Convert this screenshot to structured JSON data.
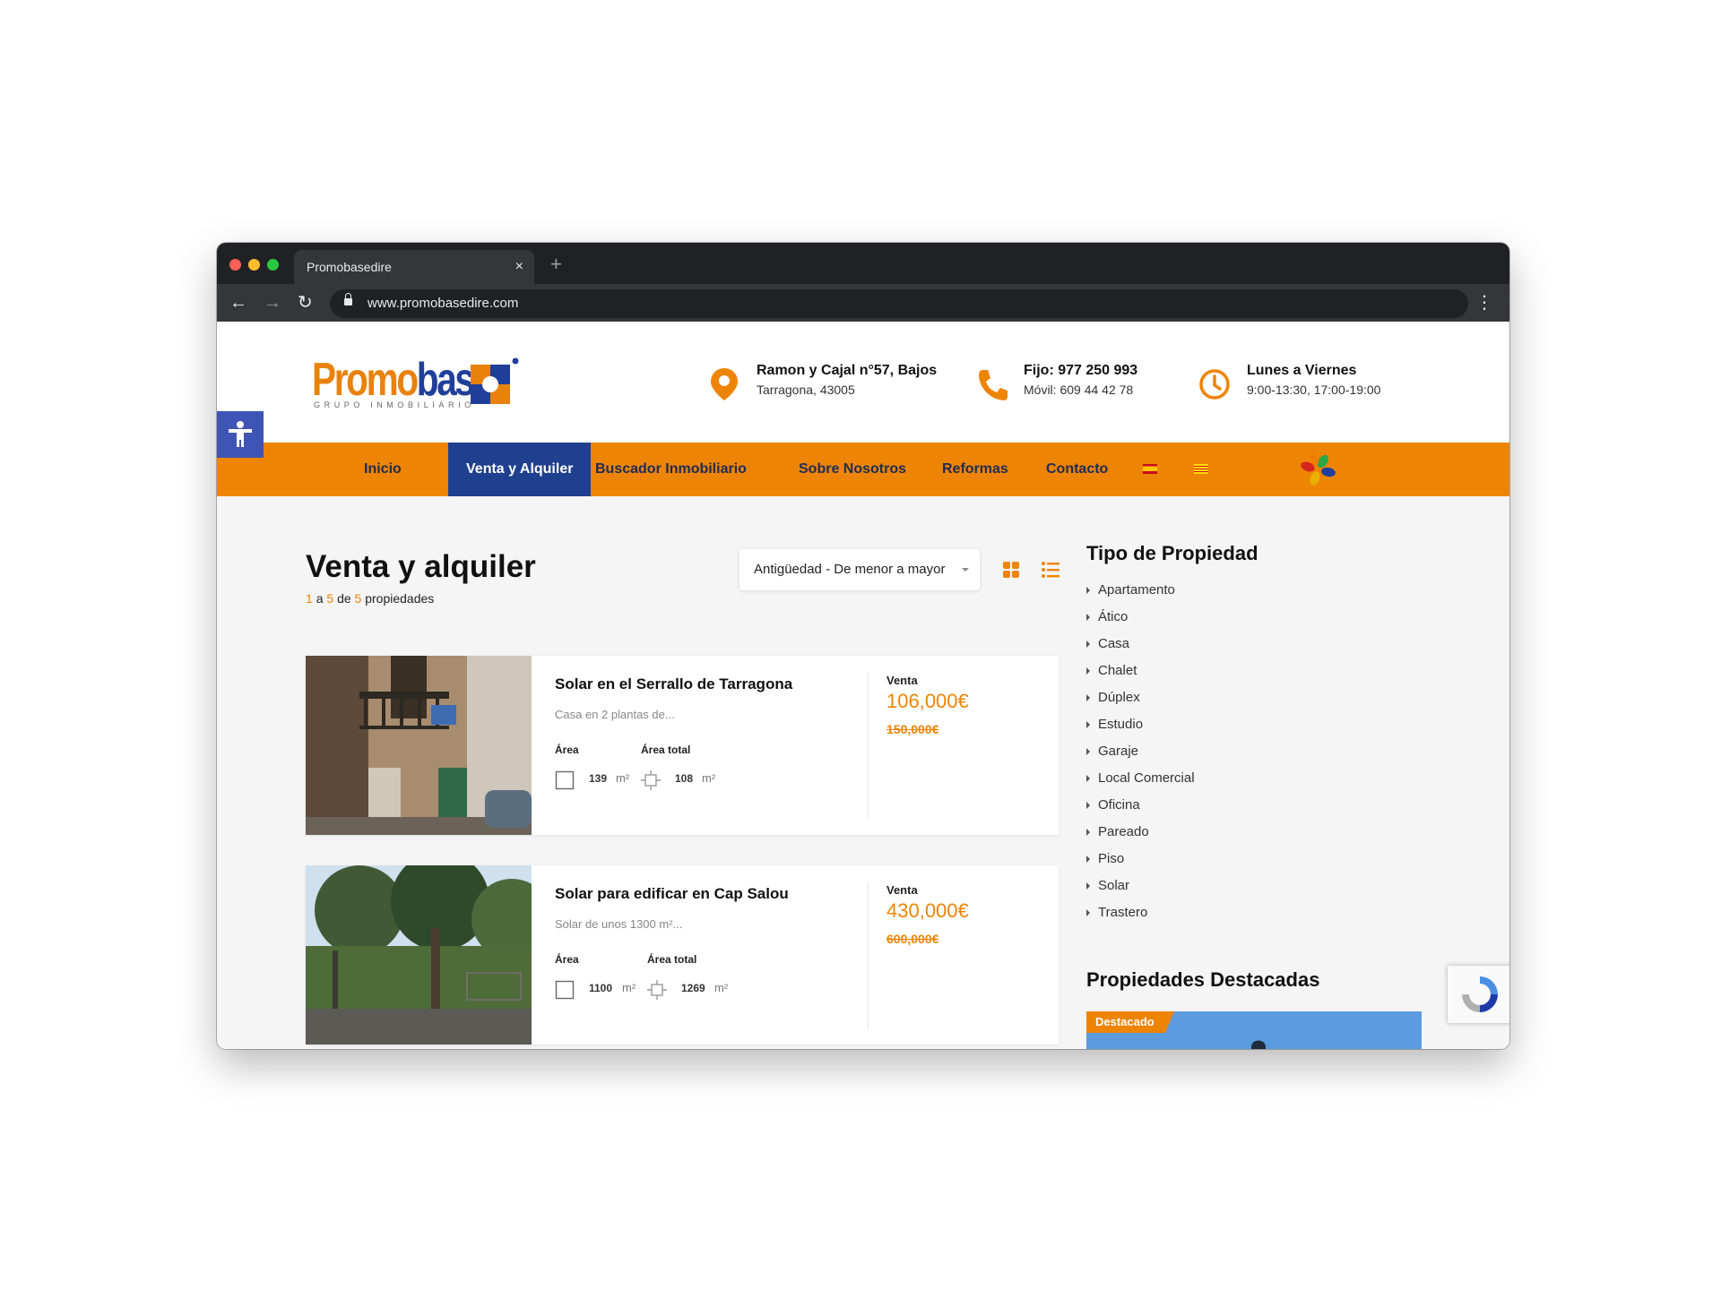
{
  "browser": {
    "tab_title": "Promobasedire",
    "tab_close": "×",
    "new_tab": "+",
    "url": "www.promobasedire.com",
    "back": "←",
    "forward": "→",
    "reload": "↻",
    "menu": "⋮"
  },
  "header": {
    "logo": {
      "promo": "Promo",
      "base": "base",
      "tagline": "GRUPO INMOBILIARIO"
    },
    "address": {
      "title": "Ramon y Cajal n°57, Bajos",
      "subtitle": "Tarragona, 43005",
      "icon": "map-pin-icon"
    },
    "phone": {
      "title": "Fijo: 977 250 993",
      "subtitle": "Móvil: 609 44 42 78",
      "icon": "phone-icon"
    },
    "hours": {
      "title": "Lunes a Viernes",
      "subtitle": "9:00-13:30, 17:00-19:00",
      "icon": "clock-icon"
    }
  },
  "nav": {
    "items": [
      {
        "label": "Inicio"
      },
      {
        "label": "Venta y Alquiler",
        "active": true
      },
      {
        "label": "Buscador Inmobiliario"
      },
      {
        "label": "Sobre Nosotros"
      },
      {
        "label": "Reformas"
      },
      {
        "label": "Contacto"
      }
    ],
    "languages": [
      "es-flag-icon",
      "ca-flag-icon"
    ]
  },
  "listing": {
    "title": "Venta y alquiler",
    "results": {
      "from": "1",
      "a": "a",
      "to": "5",
      "de": "de",
      "total": "5",
      "suffix": "propiedades"
    },
    "sort": {
      "selected": "Antigüedad - De menor a mayor"
    },
    "properties": [
      {
        "title": "Solar en el Serrallo de Tarragona",
        "description": "Casa en 2 plantas de...",
        "area_label": "Área",
        "area_total_label": "Área total",
        "area": "139",
        "area_total": "108",
        "unit": "m²",
        "price_type": "Venta",
        "price": "106,000€",
        "old_price": "150,000€"
      },
      {
        "title": "Solar para edificar en Cap Salou",
        "description": "Solar de unos 1300 m²...",
        "area_label": "Área",
        "area_total_label": "Área total",
        "area": "1100",
        "area_total": "1269",
        "unit": "m²",
        "price_type": "Venta",
        "price": "430,000€",
        "old_price": "600,000€"
      }
    ]
  },
  "sidebar": {
    "property_types_title": "Tipo de Propiedad",
    "property_types": [
      "Apartamento",
      "Ático",
      "Casa",
      "Chalet",
      "Dúplex",
      "Estudio",
      "Garaje",
      "Local Comercial",
      "Oficina",
      "Pareado",
      "Piso",
      "Solar",
      "Trastero"
    ],
    "featured_title": "Propiedades Destacadas",
    "featured_badge": "Destacado"
  },
  "colors": {
    "accent": "#ee8404",
    "navy": "#1f3f8f",
    "access_blue": "#3f55b5"
  }
}
